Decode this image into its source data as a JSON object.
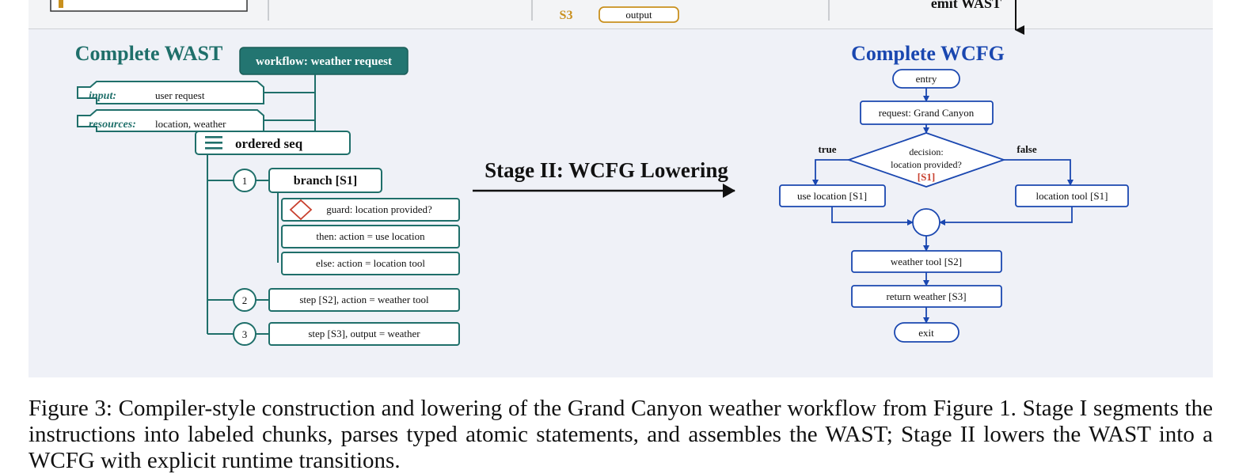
{
  "top": {
    "s3_label": "S3",
    "output_label": "output",
    "emit_label": "emit WAST"
  },
  "wast": {
    "title": "Complete WAST",
    "workflow": "workflow: weather request",
    "input_key": "input:",
    "input_value": "user request",
    "resources_key": "resources:",
    "resources_value": "location, weather",
    "seq": "ordered seq",
    "branch": "branch [S1]",
    "guard": "guard: location provided?",
    "then": "then: action = use location",
    "else": "else: action = location tool",
    "step2": "step [S2], action = weather tool",
    "step3": "step [S3], output = weather",
    "num1": "1",
    "num2": "2",
    "num3": "3"
  },
  "stage": {
    "label": "Stage II: WCFG Lowering"
  },
  "wcfg": {
    "title": "Complete WCFG",
    "entry": "entry",
    "request": "request: Grand Canyon",
    "decision_line1": "decision:",
    "decision_line2": "location provided?",
    "decision_tag": "[S1]",
    "true_label": "true",
    "false_label": "false",
    "use_location": "use location [S1]",
    "location_tool": "location tool [S1]",
    "weather_tool": "weather tool [S2]",
    "return_weather": "return weather [S3]",
    "exit": "exit"
  },
  "caption": "Figure 3: Compiler-style construction and lowering of the Grand Canyon weather workflow from Figure 1. Stage I segments the instructions into labeled chunks, parses typed atomic statements, and assembles the WAST; Stage II lowers the WAST into a WCFG with explicit runtime transitions.",
  "colors": {
    "teal": "#1f6f6a",
    "teal_fill": "#237571",
    "blue": "#1a47b0",
    "red": "#c8402e",
    "gold": "#c9901e",
    "panel_bg": "#eff1f7"
  }
}
